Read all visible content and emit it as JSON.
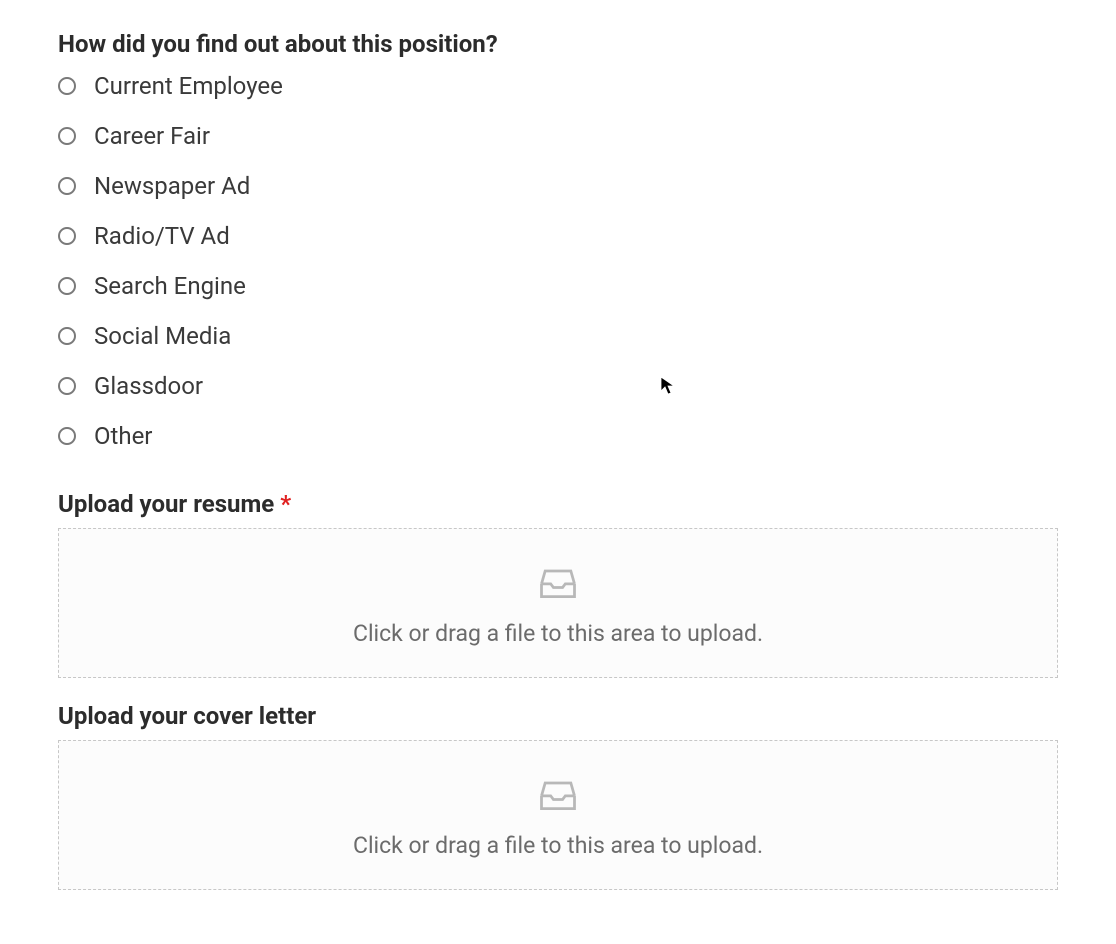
{
  "question": {
    "label": "How did you find out about this position?",
    "options": [
      "Current Employee",
      "Career Fair",
      "Newspaper Ad",
      "Radio/TV Ad",
      "Search Engine",
      "Social Media",
      "Glassdoor",
      "Other"
    ]
  },
  "uploadResume": {
    "label": "Upload your resume ",
    "required": "*",
    "hint": "Click or drag a file to this area to upload."
  },
  "uploadCoverLetter": {
    "label": "Upload your cover letter",
    "hint": "Click or drag a file to this area to upload."
  }
}
